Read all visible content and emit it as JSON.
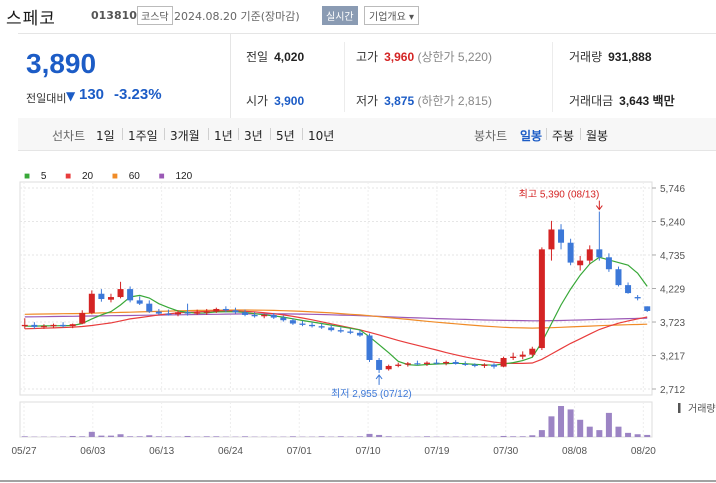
{
  "header": {
    "name": "스페코",
    "code": "013810",
    "market": "코스닥",
    "date": "2024.08.20 기준(장마감)",
    "realtime": "실시간",
    "company": "기업개요 ▾"
  },
  "summary": {
    "price": "3,890",
    "change_label": "전일대비",
    "change_icon": "down-triangle-icon",
    "change": "130",
    "change_pct": "-3.23%",
    "prev_close": {
      "label": "전일",
      "value": "4,020"
    },
    "high": {
      "label": "고가",
      "value": "3,960",
      "limit_label": "(상한가 5,220)"
    },
    "volume": {
      "label": "거래량",
      "value": "931,888"
    },
    "open": {
      "label": "시가",
      "value": "3,900"
    },
    "low": {
      "label": "저가",
      "value": "3,875",
      "limit_label": "(하한가 2,815)"
    },
    "amount": {
      "label": "거래대금",
      "value": "3,643 백만"
    }
  },
  "tabs": {
    "line_label": "선차트",
    "periods": [
      "1일",
      "1주일",
      "3개월",
      "1년",
      "3년",
      "5년",
      "10년"
    ],
    "candle_label": "봉차트",
    "candles": [
      "일봉",
      "주봉",
      "월봉"
    ],
    "active_candle": "일봉"
  },
  "colors": {
    "up": "#d42424",
    "down": "#3c78d8",
    "ma5": "#38a838",
    "ma20": "#e83c3c",
    "ma60": "#f08c28",
    "ma120": "#9b59b6",
    "volume": "#9c84c4"
  },
  "chart_data": {
    "type": "candlestick",
    "legend": [
      "5",
      "20",
      "60",
      "120"
    ],
    "volume_label": "거래량",
    "y_ticks": [
      5746,
      5240,
      4735,
      4229,
      3723,
      3217,
      2712
    ],
    "x_ticks": [
      "05/27",
      "06/03",
      "06/13",
      "06/24",
      "07/01",
      "07/10",
      "07/19",
      "07/30",
      "08/08",
      "08/20"
    ],
    "annotations": {
      "high": "최고 5,390 (08/13)",
      "low": "최저 2,955 (07/12)"
    },
    "candles": [
      {
        "o": 3660,
        "h": 3780,
        "l": 3620,
        "c": 3680
      },
      {
        "o": 3680,
        "h": 3720,
        "l": 3620,
        "c": 3650
      },
      {
        "o": 3650,
        "h": 3690,
        "l": 3620,
        "c": 3660
      },
      {
        "o": 3660,
        "h": 3700,
        "l": 3630,
        "c": 3680
      },
      {
        "o": 3680,
        "h": 3720,
        "l": 3640,
        "c": 3660
      },
      {
        "o": 3660,
        "h": 3700,
        "l": 3630,
        "c": 3690
      },
      {
        "o": 3700,
        "h": 3900,
        "l": 3690,
        "c": 3860
      },
      {
        "o": 3860,
        "h": 4200,
        "l": 3840,
        "c": 4150
      },
      {
        "o": 4150,
        "h": 4220,
        "l": 4030,
        "c": 4070
      },
      {
        "o": 4060,
        "h": 4150,
        "l": 4020,
        "c": 4100
      },
      {
        "o": 4100,
        "h": 4330,
        "l": 4080,
        "c": 4220
      },
      {
        "o": 4220,
        "h": 4260,
        "l": 4020,
        "c": 4050
      },
      {
        "o": 4050,
        "h": 4110,
        "l": 3980,
        "c": 4000
      },
      {
        "o": 4000,
        "h": 4050,
        "l": 3860,
        "c": 3880
      },
      {
        "o": 3880,
        "h": 3920,
        "l": 3830,
        "c": 3850
      },
      {
        "o": 3850,
        "h": 3910,
        "l": 3820,
        "c": 3840
      },
      {
        "o": 3840,
        "h": 3900,
        "l": 3810,
        "c": 3870
      },
      {
        "o": 3870,
        "h": 4000,
        "l": 3820,
        "c": 3850
      },
      {
        "o": 3850,
        "h": 3910,
        "l": 3830,
        "c": 3870
      },
      {
        "o": 3870,
        "h": 3920,
        "l": 3830,
        "c": 3880
      },
      {
        "o": 3880,
        "h": 3940,
        "l": 3860,
        "c": 3920
      },
      {
        "o": 3920,
        "h": 3960,
        "l": 3870,
        "c": 3900
      },
      {
        "o": 3900,
        "h": 3940,
        "l": 3850,
        "c": 3870
      },
      {
        "o": 3870,
        "h": 3910,
        "l": 3810,
        "c": 3830
      },
      {
        "o": 3830,
        "h": 3870,
        "l": 3790,
        "c": 3810
      },
      {
        "o": 3810,
        "h": 3850,
        "l": 3780,
        "c": 3830
      },
      {
        "o": 3830,
        "h": 3860,
        "l": 3770,
        "c": 3790
      },
      {
        "o": 3790,
        "h": 3820,
        "l": 3730,
        "c": 3750
      },
      {
        "o": 3750,
        "h": 3780,
        "l": 3680,
        "c": 3700
      },
      {
        "o": 3700,
        "h": 3740,
        "l": 3660,
        "c": 3680
      },
      {
        "o": 3680,
        "h": 3720,
        "l": 3640,
        "c": 3660
      },
      {
        "o": 3660,
        "h": 3700,
        "l": 3620,
        "c": 3640
      },
      {
        "o": 3640,
        "h": 3680,
        "l": 3580,
        "c": 3600
      },
      {
        "o": 3600,
        "h": 3640,
        "l": 3560,
        "c": 3580
      },
      {
        "o": 3580,
        "h": 3620,
        "l": 3540,
        "c": 3560
      },
      {
        "o": 3560,
        "h": 3600,
        "l": 3500,
        "c": 3520
      },
      {
        "o": 3520,
        "h": 3550,
        "l": 3120,
        "c": 3150
      },
      {
        "o": 3150,
        "h": 3180,
        "l": 2955,
        "c": 3000
      },
      {
        "o": 3010,
        "h": 3080,
        "l": 2990,
        "c": 3060
      },
      {
        "o": 3060,
        "h": 3110,
        "l": 3040,
        "c": 3080
      },
      {
        "o": 3080,
        "h": 3120,
        "l": 3050,
        "c": 3100
      },
      {
        "o": 3100,
        "h": 3140,
        "l": 3070,
        "c": 3090
      },
      {
        "o": 3090,
        "h": 3130,
        "l": 3060,
        "c": 3110
      },
      {
        "o": 3110,
        "h": 3160,
        "l": 3080,
        "c": 3100
      },
      {
        "o": 3100,
        "h": 3140,
        "l": 3070,
        "c": 3120
      },
      {
        "o": 3120,
        "h": 3150,
        "l": 3080,
        "c": 3090
      },
      {
        "o": 3090,
        "h": 3130,
        "l": 3060,
        "c": 3080
      },
      {
        "o": 3080,
        "h": 3100,
        "l": 3040,
        "c": 3060
      },
      {
        "o": 3060,
        "h": 3100,
        "l": 3030,
        "c": 3080
      },
      {
        "o": 3080,
        "h": 3100,
        "l": 3020,
        "c": 3050
      },
      {
        "o": 3050,
        "h": 3200,
        "l": 3040,
        "c": 3180
      },
      {
        "o": 3180,
        "h": 3260,
        "l": 3150,
        "c": 3200
      },
      {
        "o": 3200,
        "h": 3280,
        "l": 3160,
        "c": 3230
      },
      {
        "o": 3230,
        "h": 3350,
        "l": 3200,
        "c": 3320
      },
      {
        "o": 3330,
        "h": 4850,
        "l": 3300,
        "c": 4820
      },
      {
        "o": 4820,
        "h": 5250,
        "l": 4650,
        "c": 5120
      },
      {
        "o": 5120,
        "h": 5200,
        "l": 4820,
        "c": 4920
      },
      {
        "o": 4920,
        "h": 4980,
        "l": 4580,
        "c": 4620
      },
      {
        "o": 4580,
        "h": 4720,
        "l": 4500,
        "c": 4650
      },
      {
        "o": 4650,
        "h": 4880,
        "l": 4600,
        "c": 4820
      },
      {
        "o": 4820,
        "h": 5390,
        "l": 4650,
        "c": 4700
      },
      {
        "o": 4700,
        "h": 4760,
        "l": 4480,
        "c": 4520
      },
      {
        "o": 4520,
        "h": 4560,
        "l": 4260,
        "c": 4280
      },
      {
        "o": 4280,
        "h": 4320,
        "l": 4150,
        "c": 4160
      },
      {
        "o": 4100,
        "h": 4130,
        "l": 4050,
        "c": 4080
      },
      {
        "o": 3960,
        "h": 3960,
        "l": 3875,
        "c": 3890
      }
    ],
    "ma": {
      "5": [
        3660,
        3662,
        3664,
        3666,
        3668,
        3670,
        3700,
        3770,
        3830,
        3880,
        3980,
        4100,
        4125,
        4085,
        4000,
        3940,
        3890,
        3868,
        3856,
        3862,
        3876,
        3878,
        3878,
        3868,
        3848,
        3832,
        3816,
        3798,
        3772,
        3746,
        3724,
        3700,
        3676,
        3652,
        3628,
        3604,
        3500,
        3380,
        3260,
        3130,
        3080,
        3070,
        3082,
        3090,
        3096,
        3100,
        3094,
        3084,
        3078,
        3072,
        3090,
        3110,
        3140,
        3190,
        3420,
        3700,
        3980,
        4220,
        4430,
        4600,
        4700,
        4660,
        4620,
        4580,
        4460,
        4260
      ],
      "20": [
        3620,
        3625,
        3630,
        3635,
        3640,
        3645,
        3655,
        3670,
        3690,
        3710,
        3740,
        3770,
        3790,
        3810,
        3830,
        3845,
        3860,
        3870,
        3878,
        3885,
        3890,
        3892,
        3890,
        3885,
        3876,
        3864,
        3848,
        3830,
        3808,
        3784,
        3756,
        3726,
        3696,
        3666,
        3636,
        3606,
        3568,
        3528,
        3486,
        3446,
        3408,
        3372,
        3336,
        3300,
        3262,
        3228,
        3196,
        3168,
        3142,
        3118,
        3102,
        3098,
        3098,
        3104,
        3160,
        3240,
        3320,
        3400,
        3470,
        3540,
        3610,
        3660,
        3705,
        3740,
        3770,
        3800
      ],
      "60": [
        3840,
        3842,
        3844,
        3846,
        3848,
        3850,
        3852,
        3856,
        3860,
        3864,
        3868,
        3872,
        3876,
        3880,
        3884,
        3888,
        3892,
        3895,
        3898,
        3900,
        3902,
        3903,
        3904,
        3904,
        3903,
        3901,
        3898,
        3894,
        3890,
        3884,
        3876,
        3868,
        3860,
        3850,
        3840,
        3830,
        3818,
        3804,
        3790,
        3776,
        3762,
        3748,
        3734,
        3720,
        3708,
        3696,
        3684,
        3672,
        3662,
        3652,
        3644,
        3638,
        3634,
        3632,
        3634,
        3638,
        3644,
        3650,
        3656,
        3662,
        3668,
        3674,
        3678,
        3682,
        3686,
        3690
      ],
      "120": [
        3800,
        3802,
        3804,
        3806,
        3808,
        3810,
        3812,
        3814,
        3816,
        3818,
        3820,
        3822,
        3824,
        3826,
        3828,
        3830,
        3832,
        3834,
        3836,
        3838,
        3840,
        3842,
        3844,
        3845,
        3846,
        3846,
        3846,
        3845,
        3844,
        3842,
        3840,
        3836,
        3832,
        3828,
        3824,
        3820,
        3814,
        3808,
        3802,
        3796,
        3790,
        3785,
        3780,
        3775,
        3770,
        3766,
        3762,
        3758,
        3754,
        3750,
        3748,
        3746,
        3744,
        3742,
        3742,
        3744,
        3746,
        3750,
        3754,
        3758,
        3762,
        3766,
        3770,
        3774,
        3778,
        3782
      ]
    },
    "volumes": [
      20,
      10,
      10,
      10,
      15,
      30,
      20,
      150,
      40,
      40,
      80,
      20,
      20,
      50,
      20,
      20,
      10,
      30,
      10,
      20,
      20,
      10,
      10,
      20,
      10,
      10,
      10,
      10,
      20,
      10,
      10,
      20,
      10,
      20,
      10,
      20,
      90,
      60,
      20,
      10,
      10,
      10,
      20,
      10,
      10,
      10,
      10,
      10,
      10,
      10,
      30,
      20,
      20,
      50,
      200,
      600,
      900,
      800,
      500,
      300,
      200,
      700,
      300,
      120,
      80,
      60
    ]
  }
}
